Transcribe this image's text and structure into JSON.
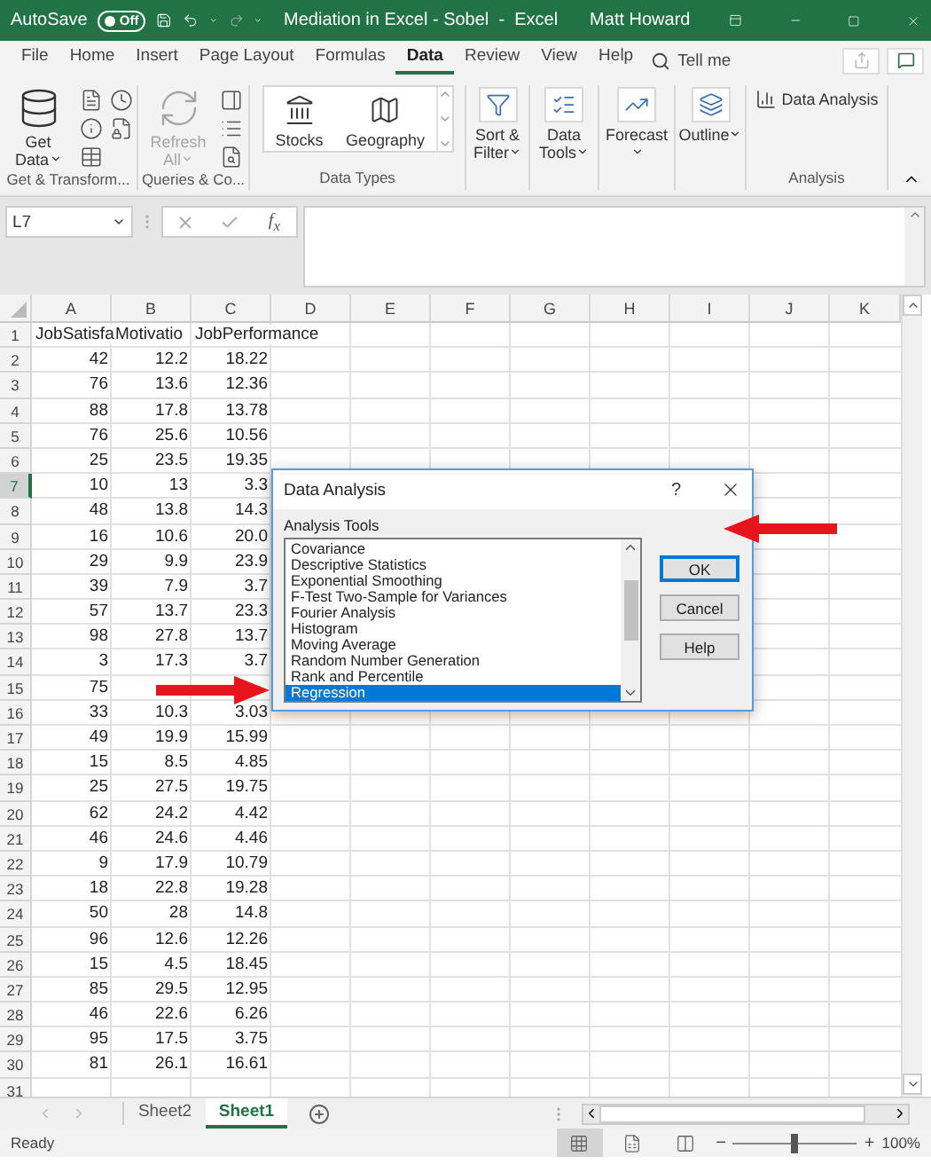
{
  "title_bar": {
    "autosave_label": "AutoSave",
    "autosave_toggle": {
      "label": "Off",
      "on": false
    },
    "title": "Mediation in Excel - Sobel  -  Excel",
    "user": "Matt Howard"
  },
  "ribbon_tabs": [
    {
      "label": "File",
      "selected": false
    },
    {
      "label": "Home",
      "selected": false
    },
    {
      "label": "Insert",
      "selected": false
    },
    {
      "label": "Page Layout",
      "selected": false
    },
    {
      "label": "Formulas",
      "selected": false
    },
    {
      "label": "Data",
      "selected": true
    },
    {
      "label": "Review",
      "selected": false
    },
    {
      "label": "View",
      "selected": false
    },
    {
      "label": "Help",
      "selected": false
    }
  ],
  "tell_me": "Tell me",
  "ribbon_groups": [
    {
      "label": "Get & Transform...",
      "items": [
        {
          "kind": "large",
          "label": "Get Data",
          "dropdown": true,
          "disabled": false
        },
        {
          "kind": "stack"
        }
      ]
    },
    {
      "label": "Queries & Co...",
      "items": [
        {
          "kind": "large",
          "label": "Refresh All",
          "dropdown": true,
          "disabled": true
        },
        {
          "kind": "stack"
        }
      ]
    },
    {
      "label": "Data Types",
      "items": [
        {
          "kind": "gallery",
          "options": [
            "Stocks",
            "Geography"
          ]
        }
      ]
    },
    {
      "items": [
        {
          "kind": "large",
          "label": "Sort & Filter",
          "dropdown": true,
          "disabled": false
        }
      ]
    },
    {
      "items": [
        {
          "kind": "large",
          "label": "Data Tools",
          "dropdown": true,
          "disabled": false
        }
      ]
    },
    {
      "items": [
        {
          "kind": "large",
          "label": "Forecast",
          "dropdown": true,
          "disabled": false
        }
      ]
    },
    {
      "items": [
        {
          "kind": "large",
          "label": "Outline",
          "dropdown": true,
          "disabled": false
        }
      ]
    },
    {
      "label": "Analysis",
      "items": [
        {
          "kind": "small",
          "label": "Data Analysis",
          "disabled": false
        }
      ]
    }
  ],
  "formula_bar": {
    "name_box": "L7",
    "function_label": "f$_{x}$"
  },
  "columns": [
    "A",
    "B",
    "C",
    "D",
    "E",
    "F",
    "G",
    "H",
    "I",
    "J",
    "K"
  ],
  "rows": [
    {
      "header": "1",
      "selected": false,
      "kind": "labels",
      "cells": [
        "JobSatisfa",
        "Motivatio",
        "JobPerformance"
      ]
    },
    {
      "header": "2",
      "selected": false,
      "kind": "values",
      "cells": [
        "42",
        "12.2",
        "18.22"
      ]
    },
    {
      "header": "3",
      "selected": false,
      "kind": "values",
      "cells": [
        "76",
        "13.6",
        "12.36"
      ]
    },
    {
      "header": "4",
      "selected": false,
      "kind": "values",
      "cells": [
        "88",
        "17.8",
        "13.78"
      ]
    },
    {
      "header": "5",
      "selected": false,
      "kind": "values",
      "cells": [
        "76",
        "25.6",
        "10.56"
      ]
    },
    {
      "header": "6",
      "selected": false,
      "kind": "values",
      "cells": [
        "25",
        "23.5",
        "19.35"
      ]
    },
    {
      "header": "7",
      "selected": true,
      "kind": "values",
      "cells": [
        "10",
        "13",
        "3.3"
      ]
    },
    {
      "header": "8",
      "selected": false,
      "kind": "values",
      "cells": [
        "48",
        "13.8",
        "14.3"
      ]
    },
    {
      "header": "9",
      "selected": false,
      "kind": "values",
      "cells": [
        "16",
        "10.6",
        "20.0"
      ]
    },
    {
      "header": "10",
      "selected": false,
      "kind": "values",
      "cells": [
        "29",
        "9.9",
        "23.9"
      ]
    },
    {
      "header": "11",
      "selected": false,
      "kind": "values",
      "cells": [
        "39",
        "7.9",
        "3.7"
      ]
    },
    {
      "header": "12",
      "selected": false,
      "kind": "values",
      "cells": [
        "57",
        "13.7",
        "23.3"
      ]
    },
    {
      "header": "13",
      "selected": false,
      "kind": "values",
      "cells": [
        "98",
        "27.8",
        "13.7"
      ]
    },
    {
      "header": "14",
      "selected": false,
      "kind": "values",
      "cells": [
        "3",
        "17.3",
        "3.7"
      ]
    },
    {
      "header": "15",
      "selected": false,
      "kind": "values",
      "cells": [
        "75"
      ]
    },
    {
      "header": "16",
      "selected": false,
      "kind": "values",
      "cells": [
        "33",
        "10.3",
        "3.03"
      ]
    },
    {
      "header": "17",
      "selected": false,
      "kind": "values",
      "cells": [
        "49",
        "19.9",
        "15.99"
      ]
    },
    {
      "header": "18",
      "selected": false,
      "kind": "values",
      "cells": [
        "15",
        "8.5",
        "4.85"
      ]
    },
    {
      "header": "19",
      "selected": false,
      "kind": "values",
      "cells": [
        "25",
        "27.5",
        "19.75"
      ]
    },
    {
      "header": "20",
      "selected": false,
      "kind": "values",
      "cells": [
        "62",
        "24.2",
        "4.42"
      ]
    },
    {
      "header": "21",
      "selected": false,
      "kind": "values",
      "cells": [
        "46",
        "24.6",
        "4.46"
      ]
    },
    {
      "header": "22",
      "selected": false,
      "kind": "values",
      "cells": [
        "9",
        "17.9",
        "10.79"
      ]
    },
    {
      "header": "23",
      "selected": false,
      "kind": "values",
      "cells": [
        "18",
        "22.8",
        "19.28"
      ]
    },
    {
      "header": "24",
      "selected": false,
      "kind": "values",
      "cells": [
        "50",
        "28",
        "14.8"
      ]
    },
    {
      "header": "25",
      "selected": false,
      "kind": "values",
      "cells": [
        "96",
        "12.6",
        "12.26"
      ]
    },
    {
      "header": "26",
      "selected": false,
      "kind": "values",
      "cells": [
        "15",
        "4.5",
        "18.45"
      ]
    },
    {
      "header": "27",
      "selected": false,
      "kind": "values",
      "cells": [
        "85",
        "29.5",
        "12.95"
      ]
    },
    {
      "header": "28",
      "selected": false,
      "kind": "values",
      "cells": [
        "46",
        "22.6",
        "6.26"
      ]
    },
    {
      "header": "29",
      "selected": false,
      "kind": "values",
      "cells": [
        "95",
        "17.5",
        "3.75"
      ]
    },
    {
      "header": "30",
      "selected": false,
      "kind": "values",
      "cells": [
        "81",
        "26.1",
        "16.61"
      ]
    },
    {
      "header": "31",
      "selected": false,
      "kind": "values",
      "cells": []
    }
  ],
  "dialog": {
    "title": "Data Analysis",
    "help_glyph": "?",
    "list_label": "Analysis Tools",
    "tools": [
      {
        "label": "Covariance",
        "selected": false
      },
      {
        "label": "Descriptive Statistics",
        "selected": false
      },
      {
        "label": "Exponential Smoothing",
        "selected": false
      },
      {
        "label": "F-Test Two-Sample for Variances",
        "selected": false
      },
      {
        "label": "Fourier Analysis",
        "selected": false
      },
      {
        "label": "Histogram",
        "selected": false
      },
      {
        "label": "Moving Average",
        "selected": false
      },
      {
        "label": "Random Number Generation",
        "selected": false
      },
      {
        "label": "Rank and Percentile",
        "selected": false
      },
      {
        "label": "Regression",
        "selected": true
      }
    ],
    "buttons": [
      {
        "label": "OK",
        "focused": true
      },
      {
        "label": "Cancel",
        "focused": false
      },
      {
        "label": "Help",
        "focused": false
      }
    ]
  },
  "sheet_tabs": [
    {
      "label": "Sheet2",
      "selected": false
    },
    {
      "label": "Sheet1",
      "selected": true
    }
  ],
  "status_bar": {
    "status": "Ready",
    "view_buttons": [
      {
        "selected": true
      },
      {
        "selected": false
      },
      {
        "selected": false
      }
    ],
    "zoom_out": "−",
    "zoom": {
      "level": 0.5
    },
    "zoom_in": "+",
    "zoom_label": "100%"
  }
}
